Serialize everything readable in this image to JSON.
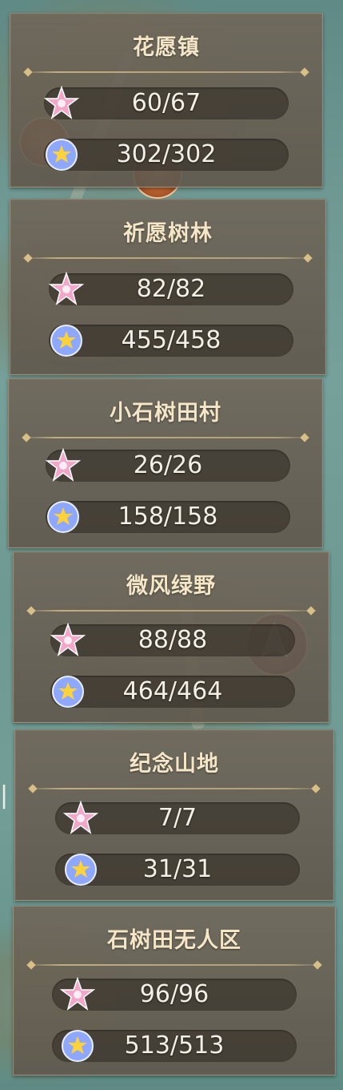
{
  "regions": [
    {
      "name": "花愿镇",
      "stars": "60/67",
      "orbs": "302/302"
    },
    {
      "name": "祈愿树林",
      "stars": "82/82",
      "orbs": "455/458"
    },
    {
      "name": "小石树田村",
      "stars": "26/26",
      "orbs": "158/158"
    },
    {
      "name": "微风绿野",
      "stars": "88/88",
      "orbs": "464/464"
    },
    {
      "name": "纪念山地",
      "stars": "7/7",
      "orbs": "31/31"
    },
    {
      "name": "石树田无人区",
      "stars": "96/96",
      "orbs": "513/513"
    }
  ],
  "icons": {
    "star_collectible": "pink-star-icon",
    "orb_collectible": "blue-orb-icon"
  },
  "colors": {
    "title": "#f4e6c6",
    "value": "#f3efe6",
    "star_pink": "#f2a7c8",
    "orb_blue": "#8fa8ff",
    "orb_star": "#ffd23a"
  }
}
